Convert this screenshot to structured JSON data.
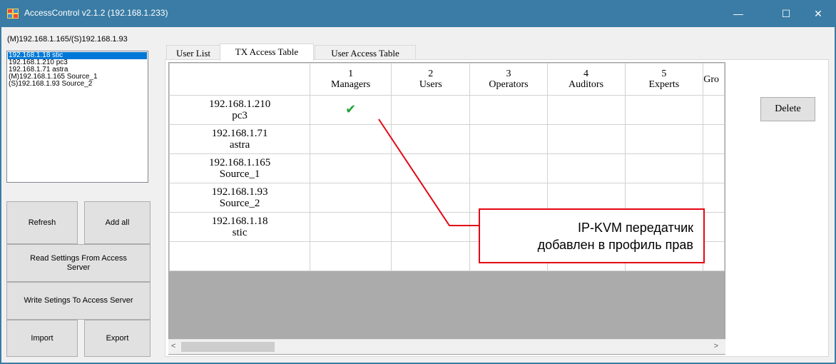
{
  "window": {
    "title": "AccessControl v2.1.2 (192.168.1.233)",
    "controls": {
      "minimize": "—",
      "maximize": "☐",
      "close": "✕"
    }
  },
  "sidebar": {
    "server_label": "(M)192.168.1.165/(S)192.168.1.93",
    "devices": [
      {
        "label": "192.168.1.18 stic",
        "selected": true
      },
      {
        "label": "192.168.1.210 pc3",
        "selected": false
      },
      {
        "label": "192.168.1.71 astra",
        "selected": false
      },
      {
        "label": "(M)192.168.1.165 Source_1",
        "selected": false
      },
      {
        "label": "(S)192.168.1.93 Source_2",
        "selected": false
      }
    ],
    "buttons": {
      "refresh": "Refresh",
      "add_all": "Add all",
      "read_settings": "Read Settings From Access Server",
      "write_settings": "Write Setings To Access Server",
      "import": "Import",
      "export": "Export"
    }
  },
  "tabs": [
    {
      "label": "User List",
      "active": false
    },
    {
      "label": "TX Access Table",
      "active": true
    },
    {
      "label": "User Access Table",
      "active": false
    }
  ],
  "table": {
    "columns": [
      {
        "num": "1",
        "name": "Managers"
      },
      {
        "num": "2",
        "name": "Users"
      },
      {
        "num": "3",
        "name": "Operators"
      },
      {
        "num": "4",
        "name": "Auditors"
      },
      {
        "num": "5",
        "name": "Experts"
      },
      {
        "num": "",
        "name": "Gro"
      }
    ],
    "rows": [
      {
        "ip": "192.168.1.210",
        "name": "pc3",
        "checked": [
          true,
          false,
          false,
          false,
          false,
          false
        ]
      },
      {
        "ip": "192.168.1.71",
        "name": "astra",
        "checked": [
          false,
          false,
          false,
          false,
          false,
          false
        ]
      },
      {
        "ip": "192.168.1.165",
        "name": "Source_1",
        "checked": [
          false,
          false,
          false,
          false,
          false,
          false
        ]
      },
      {
        "ip": "192.168.1.93",
        "name": "Source_2",
        "checked": [
          false,
          false,
          false,
          false,
          false,
          false
        ]
      },
      {
        "ip": "192.168.1.18",
        "name": "stic",
        "checked": [
          false,
          false,
          false,
          false,
          false,
          false
        ]
      }
    ],
    "check_glyph": "✔"
  },
  "scrollbar": {
    "left_arrow": "<",
    "right_arrow": ">"
  },
  "delete_label": "Delete",
  "callout": {
    "line1": "IP-KVM передатчик",
    "line2": "добавлен в профиль прав",
    "color": "#e30613"
  }
}
